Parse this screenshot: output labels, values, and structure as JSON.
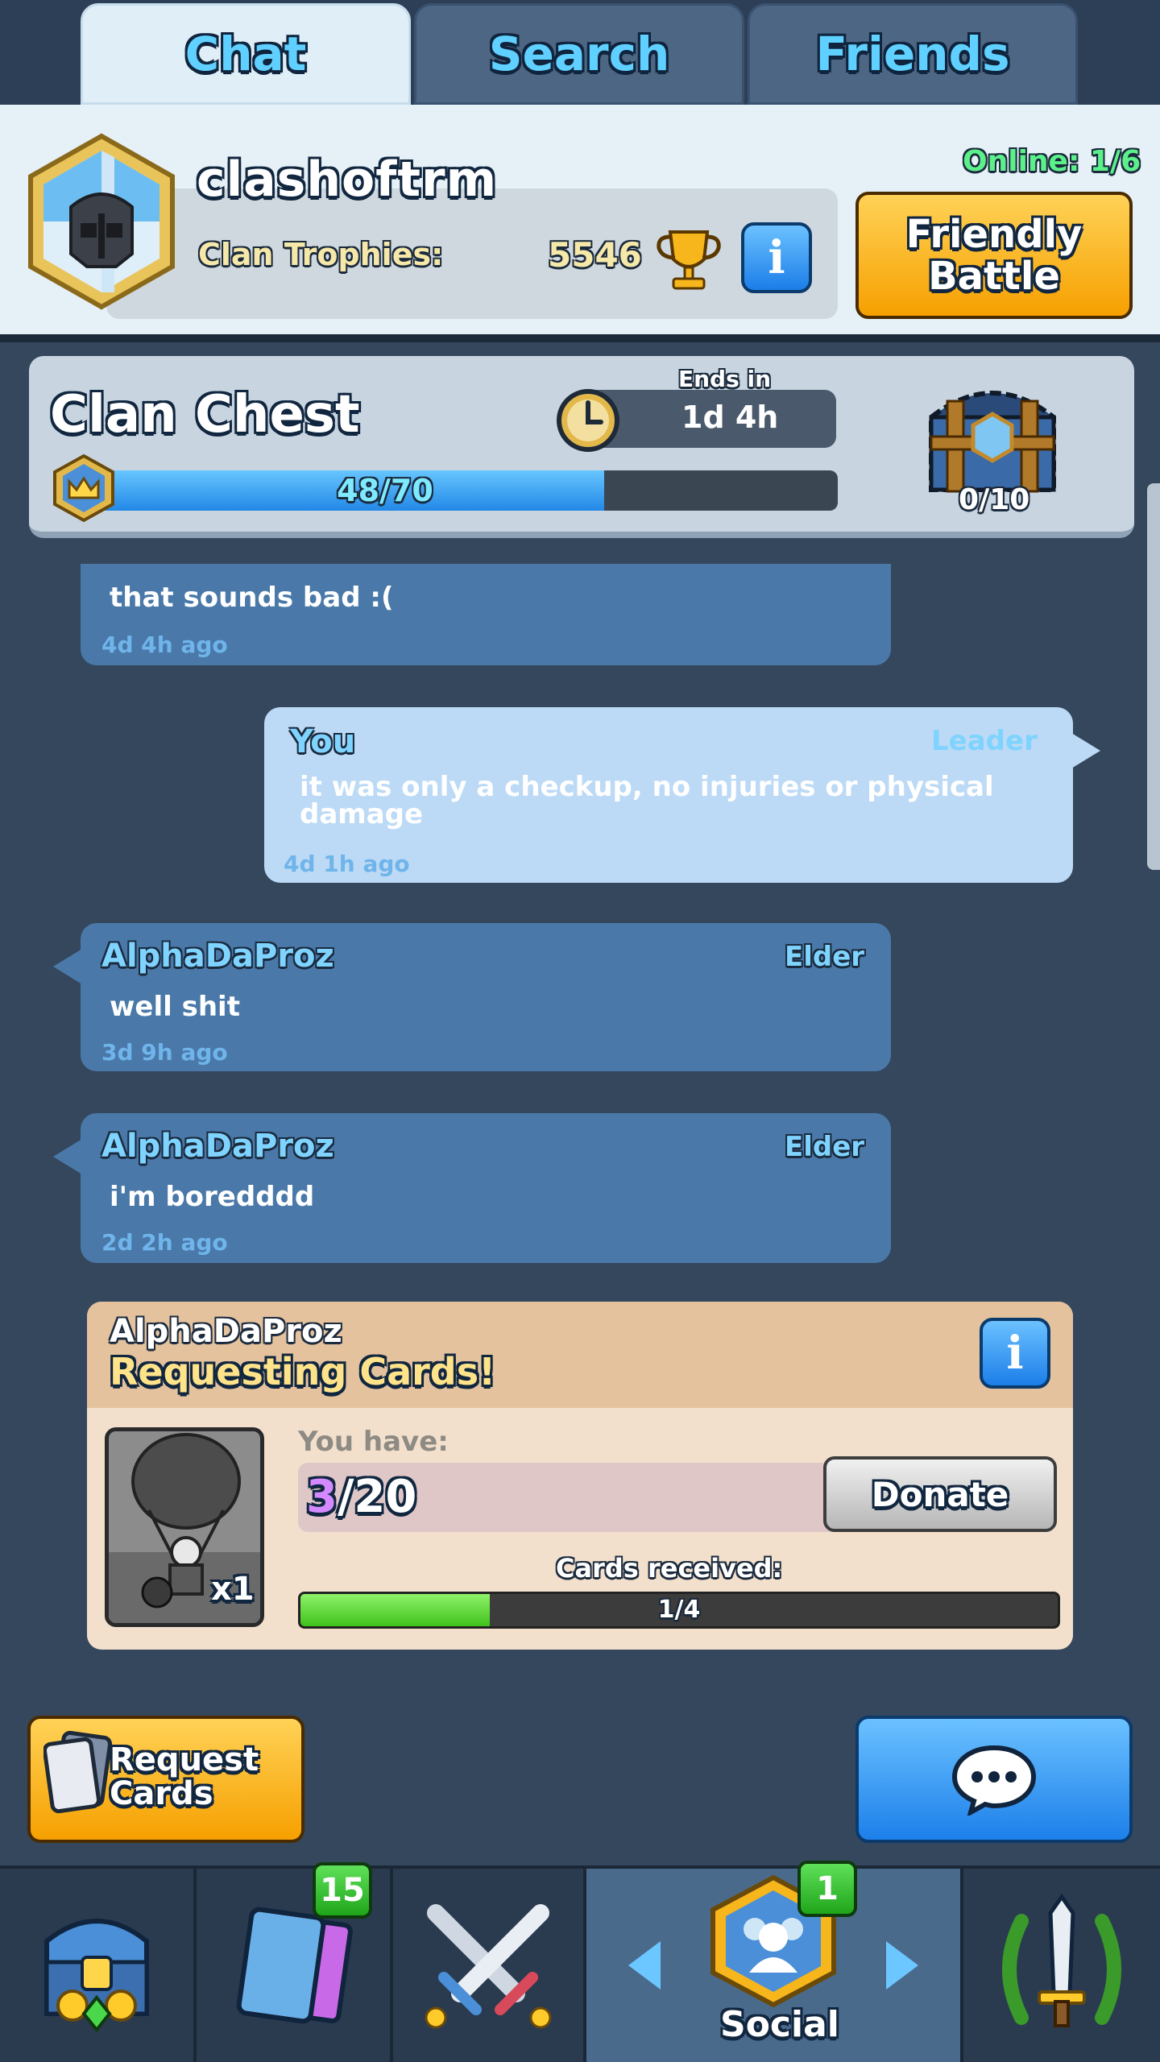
{
  "tabs": [
    {
      "label": "Chat"
    },
    {
      "label": "Search"
    },
    {
      "label": "Friends"
    }
  ],
  "clan": {
    "name": "clashoftrm",
    "trophies_label": "Clan Trophies:",
    "trophies_value": "5546",
    "online": "Online: 1/6",
    "friendly_battle_line1": "Friendly",
    "friendly_battle_line2": "Battle",
    "info_glyph": "i"
  },
  "clan_chest": {
    "title": "Clan Chest",
    "ends_in_label": "Ends in",
    "ends_in_value": "1d 4h",
    "progress_text": "48/70",
    "progress_fraction": 0.686,
    "chest_count": "0/10"
  },
  "messages": [
    {
      "name": "",
      "role": "",
      "text": "that sounds bad :(",
      "time": "4d 4h ago"
    },
    {
      "name": "You",
      "role": "Leader",
      "text": "it was only a checkup, no injuries or physical damage",
      "time": "4d 1h ago"
    },
    {
      "name": "AlphaDaProz",
      "role": "Elder",
      "text": "well shit",
      "time": "3d 9h ago"
    },
    {
      "name": "AlphaDaProz",
      "role": "Elder",
      "text": "i'm boredddd",
      "time": "2d 2h ago"
    }
  ],
  "card_request": {
    "name": "AlphaDaProz",
    "title": "Requesting Cards!",
    "card_qty": "x1",
    "you_have_label": "You have:",
    "have_current": "3",
    "have_total": "/20",
    "donate_label": "Donate",
    "received_label": "Cards received:",
    "received_text": "1/4",
    "received_fraction": 0.25
  },
  "actions": {
    "request_line1": "Request",
    "request_line2": "Cards"
  },
  "nav": {
    "cards_badge": "15",
    "social_badge": "1",
    "social_label": "Social",
    "items": [
      "shop-chest-icon",
      "cards-icon",
      "battle-swords-icon",
      "social-icon",
      "tournament-icon"
    ]
  },
  "colors": {
    "background": "#35475c",
    "accent_blue": "#5fd0ff",
    "button_yellow": "#f6a000",
    "button_blue": "#1d80ea",
    "online_green": "#5cf08a"
  }
}
